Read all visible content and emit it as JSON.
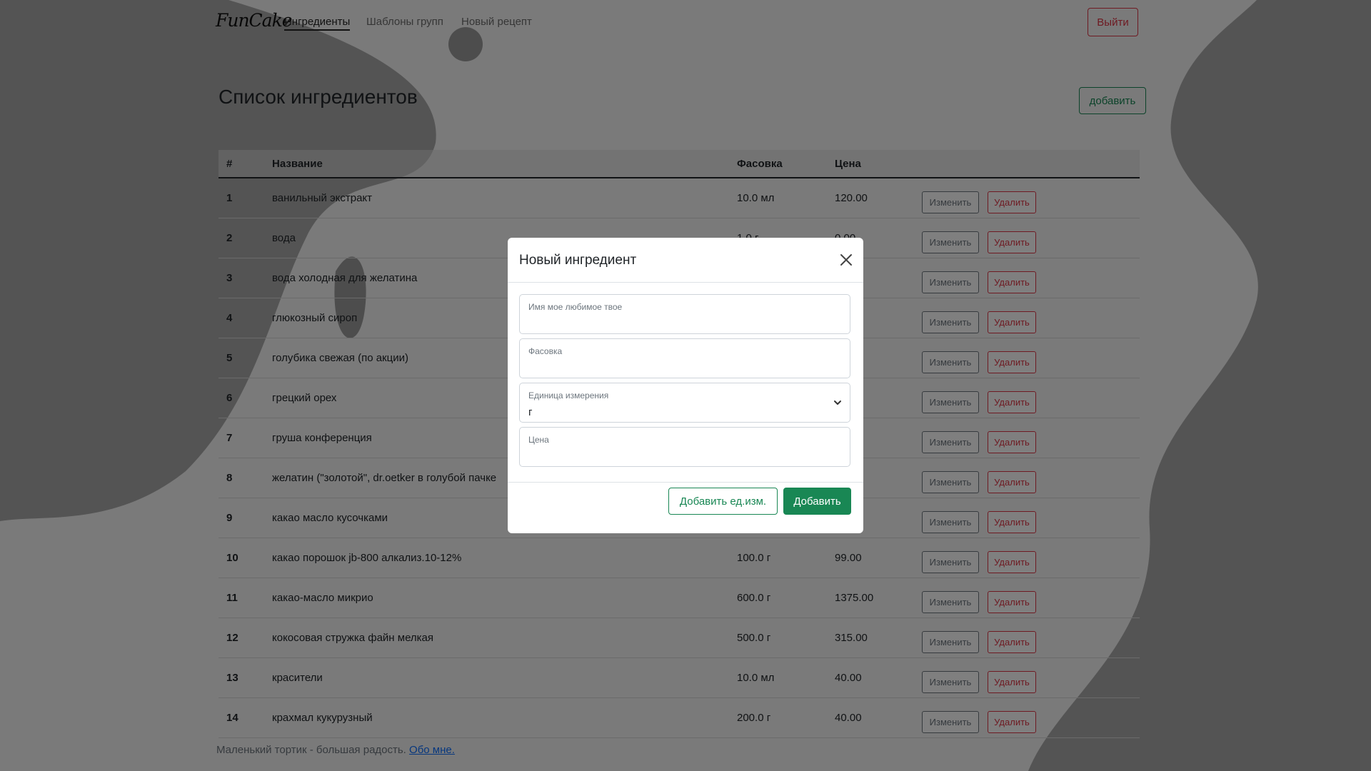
{
  "nav": {
    "logo": "FunCake",
    "links": [
      {
        "label": "Ингредиенты",
        "active": true
      },
      {
        "label": "Шаблоны групп",
        "active": false
      },
      {
        "label": "Новый рецепт",
        "active": false
      }
    ],
    "logout_label": "Выйти"
  },
  "header": {
    "title": "Список ингредиентов",
    "add_label": "добавить"
  },
  "table": {
    "columns": [
      "#",
      "Название",
      "Фасовка",
      "Цена"
    ],
    "edit_label": "Изменить",
    "delete_label": "Удалить",
    "rows": [
      {
        "n": "1",
        "name": "ванильный экстракт",
        "pack": "10.0 мл",
        "price": "120.00"
      },
      {
        "n": "2",
        "name": "вода",
        "pack": "1.0 г",
        "price": "0.00"
      },
      {
        "n": "3",
        "name": "вода холодная для желатина",
        "pack": "",
        "price": ""
      },
      {
        "n": "4",
        "name": "глюкозный сироп",
        "pack": "",
        "price": ".00"
      },
      {
        "n": "5",
        "name": "голубика свежая (по акции)",
        "pack": "",
        "price": "0"
      },
      {
        "n": "6",
        "name": "грецкий орех",
        "pack": "",
        "price": ""
      },
      {
        "n": "7",
        "name": "груша конференция",
        "pack": "",
        "price": ""
      },
      {
        "n": "8",
        "name": "желатин (\"золотой\", dr.oetker в голубой пачке",
        "pack": "",
        "price": "0"
      },
      {
        "n": "9",
        "name": "какао масло кусочками",
        "pack": "",
        "price": ".00"
      },
      {
        "n": "10",
        "name": "какао порошок jb-800 алкализ.10-12%",
        "pack": "100.0 г",
        "price": "99.00"
      },
      {
        "n": "11",
        "name": "какао-масло микрио",
        "pack": "600.0 г",
        "price": "1375.00"
      },
      {
        "n": "12",
        "name": "кокосовая стружка файн мелкая",
        "pack": "500.0 г",
        "price": "315.00"
      },
      {
        "n": "13",
        "name": "красители",
        "pack": "10.0 мл",
        "price": "40.00"
      },
      {
        "n": "14",
        "name": "крахмал кукурузный",
        "pack": "200.0 г",
        "price": "40.00"
      }
    ]
  },
  "footer": {
    "text": "Маленький тортик - большая радость. ",
    "link": "Обо мне."
  },
  "modal": {
    "title": "Новый ингредиент",
    "fields": {
      "name_label": "Имя мое любимое твое",
      "pack_label": "Фасовка",
      "unit_label": "Единица измерения",
      "unit_value": "г",
      "price_label": "Цена"
    },
    "add_unit_label": "Добавить ед.изм.",
    "submit_label": "Добавить"
  },
  "colors": {
    "success": "#198754",
    "danger": "#dc3545",
    "secondary": "#6c757d",
    "link": "#0d6efd"
  }
}
